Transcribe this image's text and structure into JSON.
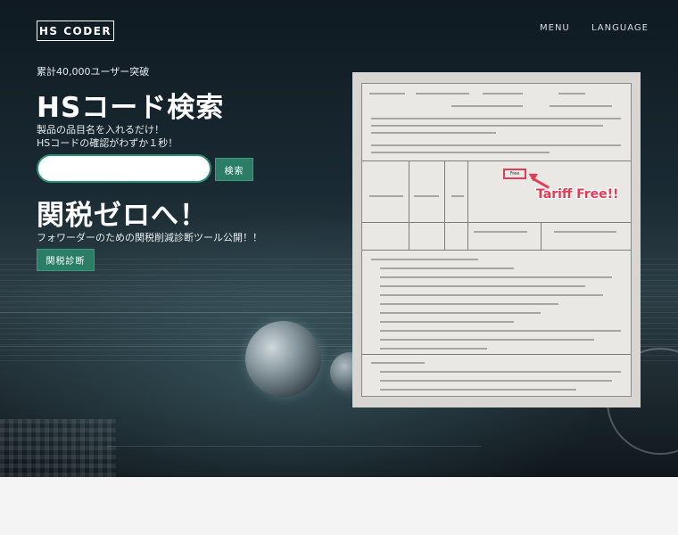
{
  "header": {
    "logo": "HS CODER",
    "nav": [
      {
        "label": "MENU"
      },
      {
        "label": "LANGUAGE"
      }
    ]
  },
  "hero": {
    "users_count": "累計40,000ユーザー突破",
    "title": "HSコード検索",
    "desc_line1": "製品の品目名を入れるだけ！",
    "desc_line2": "HSコードの確認がわずか１秒！",
    "search": {
      "placeholder": "",
      "value": "",
      "button_label": "検索"
    },
    "zero_title": "関税ゼロへ！",
    "forwarder_text": "フォワーダーのための関税削減診断ツール公開！！",
    "diagnosis_button": "関税診断"
  },
  "document_image": {
    "free_label": "Free",
    "annotation": "Tariff Free!!",
    "accent_color": "#e53a55"
  },
  "colors": {
    "accent_green": "#2b7d66",
    "hero_dark": "#0f1a22",
    "footer_bg": "#f4f4f4"
  }
}
